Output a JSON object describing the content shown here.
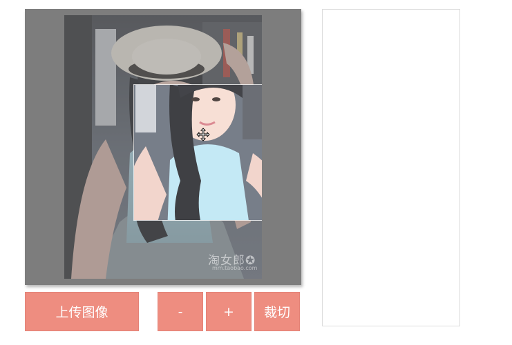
{
  "editor": {
    "watermark": "淘女郎✪",
    "watermark_sub": "mm.taobao.com"
  },
  "toolbar": {
    "upload_label": "上传图像",
    "zoom_out_label": "-",
    "zoom_in_label": "+",
    "crop_label": "裁切"
  },
  "colors": {
    "button_bg": "#ee8d80",
    "stage_bg": "#7d7d7d",
    "preview_border": "#dcdcdc"
  },
  "icons": {
    "move_cursor": "move-icon"
  }
}
